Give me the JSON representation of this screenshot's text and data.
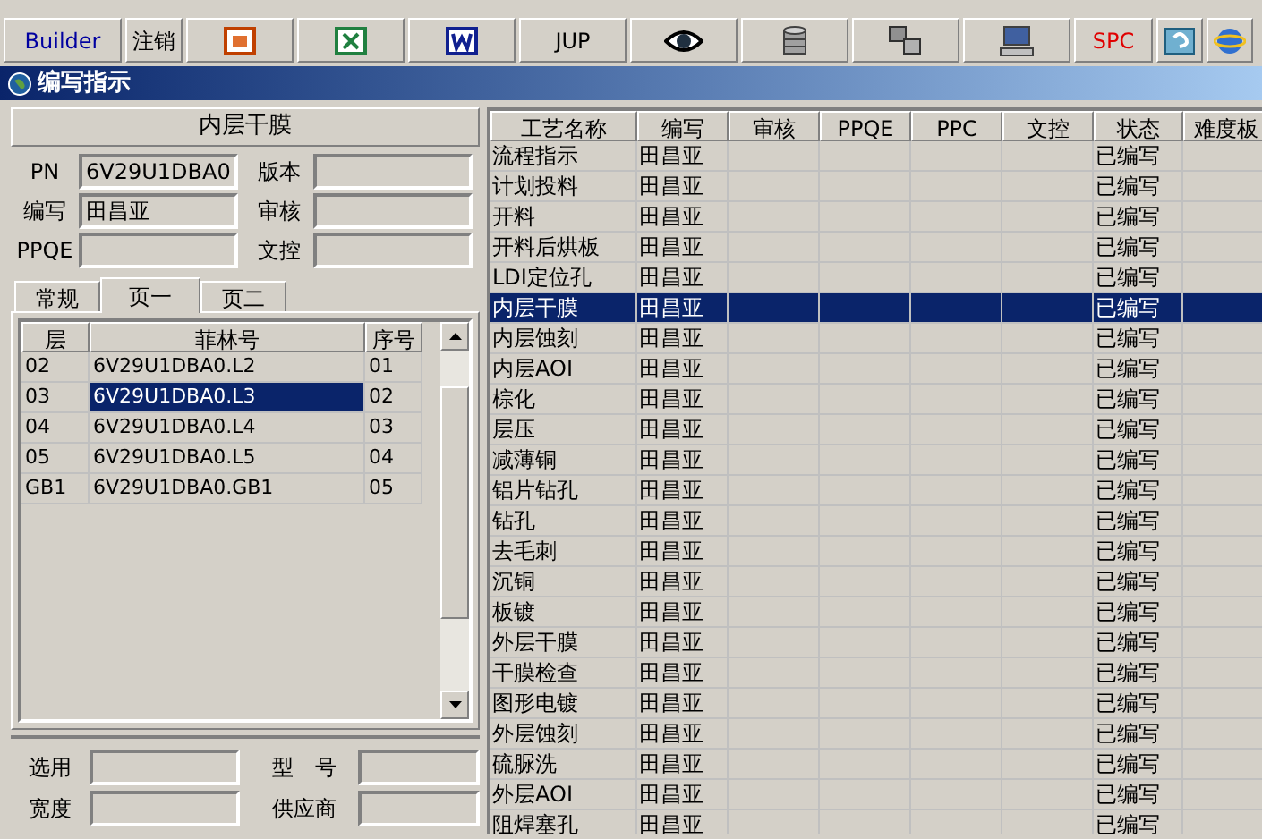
{
  "toolbar": [
    {
      "kind": "text",
      "label": "Builder",
      "color": "#0000a0"
    },
    {
      "kind": "text",
      "label": "注销",
      "color": "#000000"
    },
    {
      "kind": "icon"
    },
    {
      "kind": "icon"
    },
    {
      "kind": "icon"
    },
    {
      "kind": "text",
      "label": "JUP",
      "color": "#000000"
    },
    {
      "kind": "icon"
    },
    {
      "kind": "icon"
    },
    {
      "kind": "icon"
    },
    {
      "kind": "icon"
    },
    {
      "kind": "text",
      "label": "SPC",
      "color": "#e00000"
    },
    {
      "kind": "icon"
    },
    {
      "kind": "icon"
    }
  ],
  "window": {
    "title": "编写指示"
  },
  "left_panel": {
    "heading": "内层干膜",
    "fields": [
      {
        "label": "PN",
        "value": "6V29U1DBA0"
      },
      {
        "label": "版本"
      },
      {
        "label": "编写",
        "value": "田昌亚"
      },
      {
        "label": "审核"
      },
      {
        "label": "PPQE"
      },
      {
        "label": "文控"
      }
    ],
    "tabs": [
      {
        "label": "常规",
        "selected": false
      },
      {
        "label": "页一",
        "selected": true
      },
      {
        "label": "页二",
        "selected": false
      }
    ],
    "film_table": {
      "columns": [
        "层",
        "菲林号",
        "序号"
      ],
      "rows": [
        {
          "cells": [
            "02",
            "6V29U1DBA0.L2",
            "01"
          ],
          "selected": false
        },
        {
          "cells": [
            "03",
            "6V29U1DBA0.L3",
            "02"
          ],
          "selected": true
        },
        {
          "cells": [
            "04",
            "6V29U1DBA0.L4",
            "03"
          ],
          "selected": false
        },
        {
          "cells": [
            "05",
            "6V29U1DBA0.L5",
            "04"
          ],
          "selected": false
        },
        {
          "cells": [
            "GB1",
            "6V29U1DBA0.GB1",
            "05"
          ],
          "selected": false
        }
      ]
    },
    "bottom_fields": [
      {
        "label": "选用"
      },
      {
        "label": "型　号"
      },
      {
        "label": "宽度"
      },
      {
        "label": "供应商"
      }
    ]
  },
  "process_table": {
    "columns": [
      "工艺名称",
      "编写",
      "审核",
      "PPQE",
      "PPC",
      "文控",
      "状态",
      "难度板"
    ],
    "rows": [
      {
        "cells": [
          "流程指示",
          "田昌亚",
          "",
          "",
          "",
          "",
          "已编写",
          ""
        ],
        "selected": false
      },
      {
        "cells": [
          "计划投料",
          "田昌亚",
          "",
          "",
          "",
          "",
          "已编写",
          ""
        ],
        "selected": false
      },
      {
        "cells": [
          "开料",
          "田昌亚",
          "",
          "",
          "",
          "",
          "已编写",
          ""
        ],
        "selected": false
      },
      {
        "cells": [
          "开料后烘板",
          "田昌亚",
          "",
          "",
          "",
          "",
          "已编写",
          ""
        ],
        "selected": false
      },
      {
        "cells": [
          "LDI定位孔",
          "田昌亚",
          "",
          "",
          "",
          "",
          "已编写",
          ""
        ],
        "selected": false
      },
      {
        "cells": [
          "内层干膜",
          "田昌亚",
          "",
          "",
          "",
          "",
          "已编写",
          ""
        ],
        "selected": true
      },
      {
        "cells": [
          "内层蚀刻",
          "田昌亚",
          "",
          "",
          "",
          "",
          "已编写",
          ""
        ],
        "selected": false
      },
      {
        "cells": [
          "内层AOI",
          "田昌亚",
          "",
          "",
          "",
          "",
          "已编写",
          ""
        ],
        "selected": false
      },
      {
        "cells": [
          "棕化",
          "田昌亚",
          "",
          "",
          "",
          "",
          "已编写",
          ""
        ],
        "selected": false
      },
      {
        "cells": [
          "层压",
          "田昌亚",
          "",
          "",
          "",
          "",
          "已编写",
          ""
        ],
        "selected": false
      },
      {
        "cells": [
          "减薄铜",
          "田昌亚",
          "",
          "",
          "",
          "",
          "已编写",
          ""
        ],
        "selected": false
      },
      {
        "cells": [
          "铝片钻孔",
          "田昌亚",
          "",
          "",
          "",
          "",
          "已编写",
          ""
        ],
        "selected": false
      },
      {
        "cells": [
          "钻孔",
          "田昌亚",
          "",
          "",
          "",
          "",
          "已编写",
          ""
        ],
        "selected": false
      },
      {
        "cells": [
          "去毛刺",
          "田昌亚",
          "",
          "",
          "",
          "",
          "已编写",
          ""
        ],
        "selected": false
      },
      {
        "cells": [
          "沉铜",
          "田昌亚",
          "",
          "",
          "",
          "",
          "已编写",
          ""
        ],
        "selected": false
      },
      {
        "cells": [
          "板镀",
          "田昌亚",
          "",
          "",
          "",
          "",
          "已编写",
          ""
        ],
        "selected": false
      },
      {
        "cells": [
          "外层干膜",
          "田昌亚",
          "",
          "",
          "",
          "",
          "已编写",
          ""
        ],
        "selected": false
      },
      {
        "cells": [
          "干膜检查",
          "田昌亚",
          "",
          "",
          "",
          "",
          "已编写",
          ""
        ],
        "selected": false
      },
      {
        "cells": [
          "图形电镀",
          "田昌亚",
          "",
          "",
          "",
          "",
          "已编写",
          ""
        ],
        "selected": false
      },
      {
        "cells": [
          "外层蚀刻",
          "田昌亚",
          "",
          "",
          "",
          "",
          "已编写",
          ""
        ],
        "selected": false
      },
      {
        "cells": [
          "硫脲洗",
          "田昌亚",
          "",
          "",
          "",
          "",
          "已编写",
          ""
        ],
        "selected": false
      },
      {
        "cells": [
          "外层AOI",
          "田昌亚",
          "",
          "",
          "",
          "",
          "已编写",
          ""
        ],
        "selected": false
      },
      {
        "cells": [
          "阻焊塞孔",
          "田昌亚",
          "",
          "",
          "",
          "",
          "已编写",
          ""
        ],
        "selected": false
      }
    ]
  }
}
